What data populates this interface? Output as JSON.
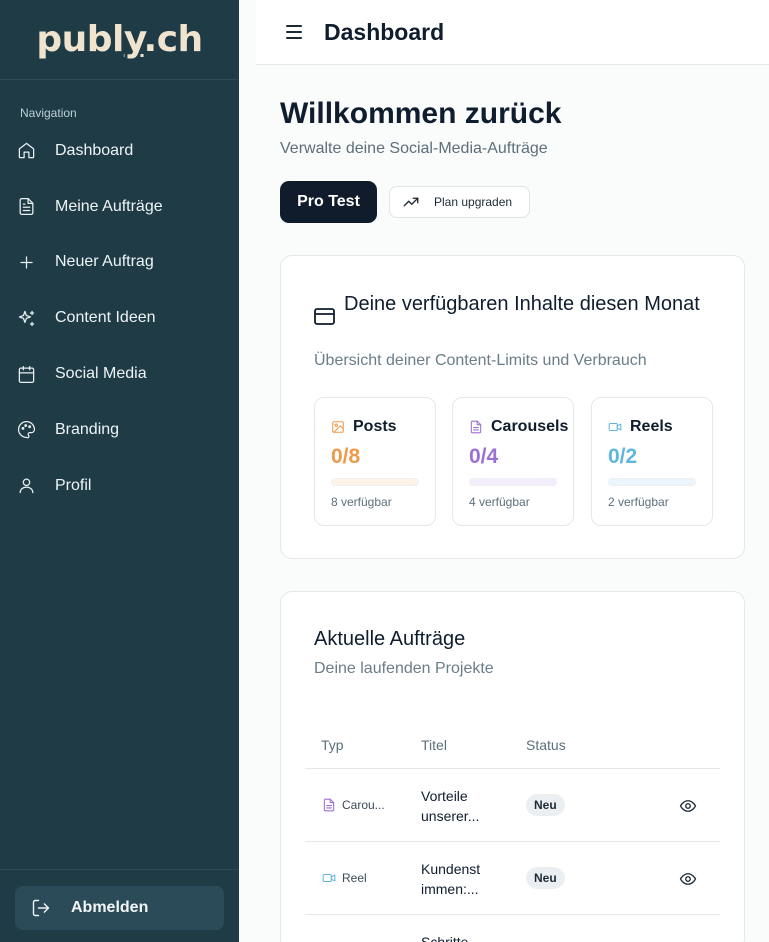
{
  "sidebar": {
    "logo": {
      "part1": "publ",
      "part2": "y",
      "part3": ".ch"
    },
    "nav_label": "Navigation",
    "items": [
      {
        "label": "Dashboard",
        "icon": "home-icon"
      },
      {
        "label": "Meine Aufträge",
        "icon": "file-icon"
      },
      {
        "label": "Neuer Auftrag",
        "icon": "plus-icon"
      },
      {
        "label": "Content Ideen",
        "icon": "sparkles-icon"
      },
      {
        "label": "Social Media",
        "icon": "calendar-icon"
      },
      {
        "label": "Branding",
        "icon": "palette-icon"
      },
      {
        "label": "Profil",
        "icon": "user-icon"
      }
    ],
    "logout_label": "Abmelden"
  },
  "header": {
    "title": "Dashboard"
  },
  "main": {
    "title": "Willkommen zurück",
    "subtitle": "Verwalte deine Social-Media-Aufträge",
    "plan_badge": "Pro Test",
    "upgrade_label": "Plan upgraden"
  },
  "limits_card": {
    "title": "Deine verfügbaren Inhalte diesen Monat",
    "subtitle": "Übersicht deiner Content-Limits und Verbrauch",
    "items": [
      {
        "label": "Posts",
        "value": "0/8",
        "used": 0,
        "total": 8,
        "available": "8 verfügbar",
        "color": "#ee9a4a",
        "track": "#fdf3e6"
      },
      {
        "label": "Carousels",
        "value": "0/4",
        "used": 0,
        "total": 4,
        "available": "4 verfügbar",
        "color": "#9b6fd6",
        "track": "#f2ecfb"
      },
      {
        "label": "Reels",
        "value": "0/2",
        "used": 0,
        "total": 2,
        "available": "2 verfügbar",
        "color": "#5fb7de",
        "track": "#eaf6fb"
      }
    ]
  },
  "orders_card": {
    "title": "Aktuelle Aufträge",
    "subtitle": "Deine laufenden Projekte",
    "columns": {
      "type": "Typ",
      "title": "Titel",
      "status": "Status"
    },
    "rows": [
      {
        "type": "Carou...",
        "type_icon": "file-icon",
        "type_color": "#9b6fd6",
        "title": "Vorteile unserer...",
        "status": "Neu"
      },
      {
        "type": "Reel",
        "type_icon": "video-icon",
        "type_color": "#5fb7de",
        "title": "Kundenst immen:...",
        "status": "Neu"
      },
      {
        "type": "",
        "type_icon": "",
        "type_color": "#9b6fd6",
        "title": "Schritte",
        "status": ""
      }
    ]
  }
}
